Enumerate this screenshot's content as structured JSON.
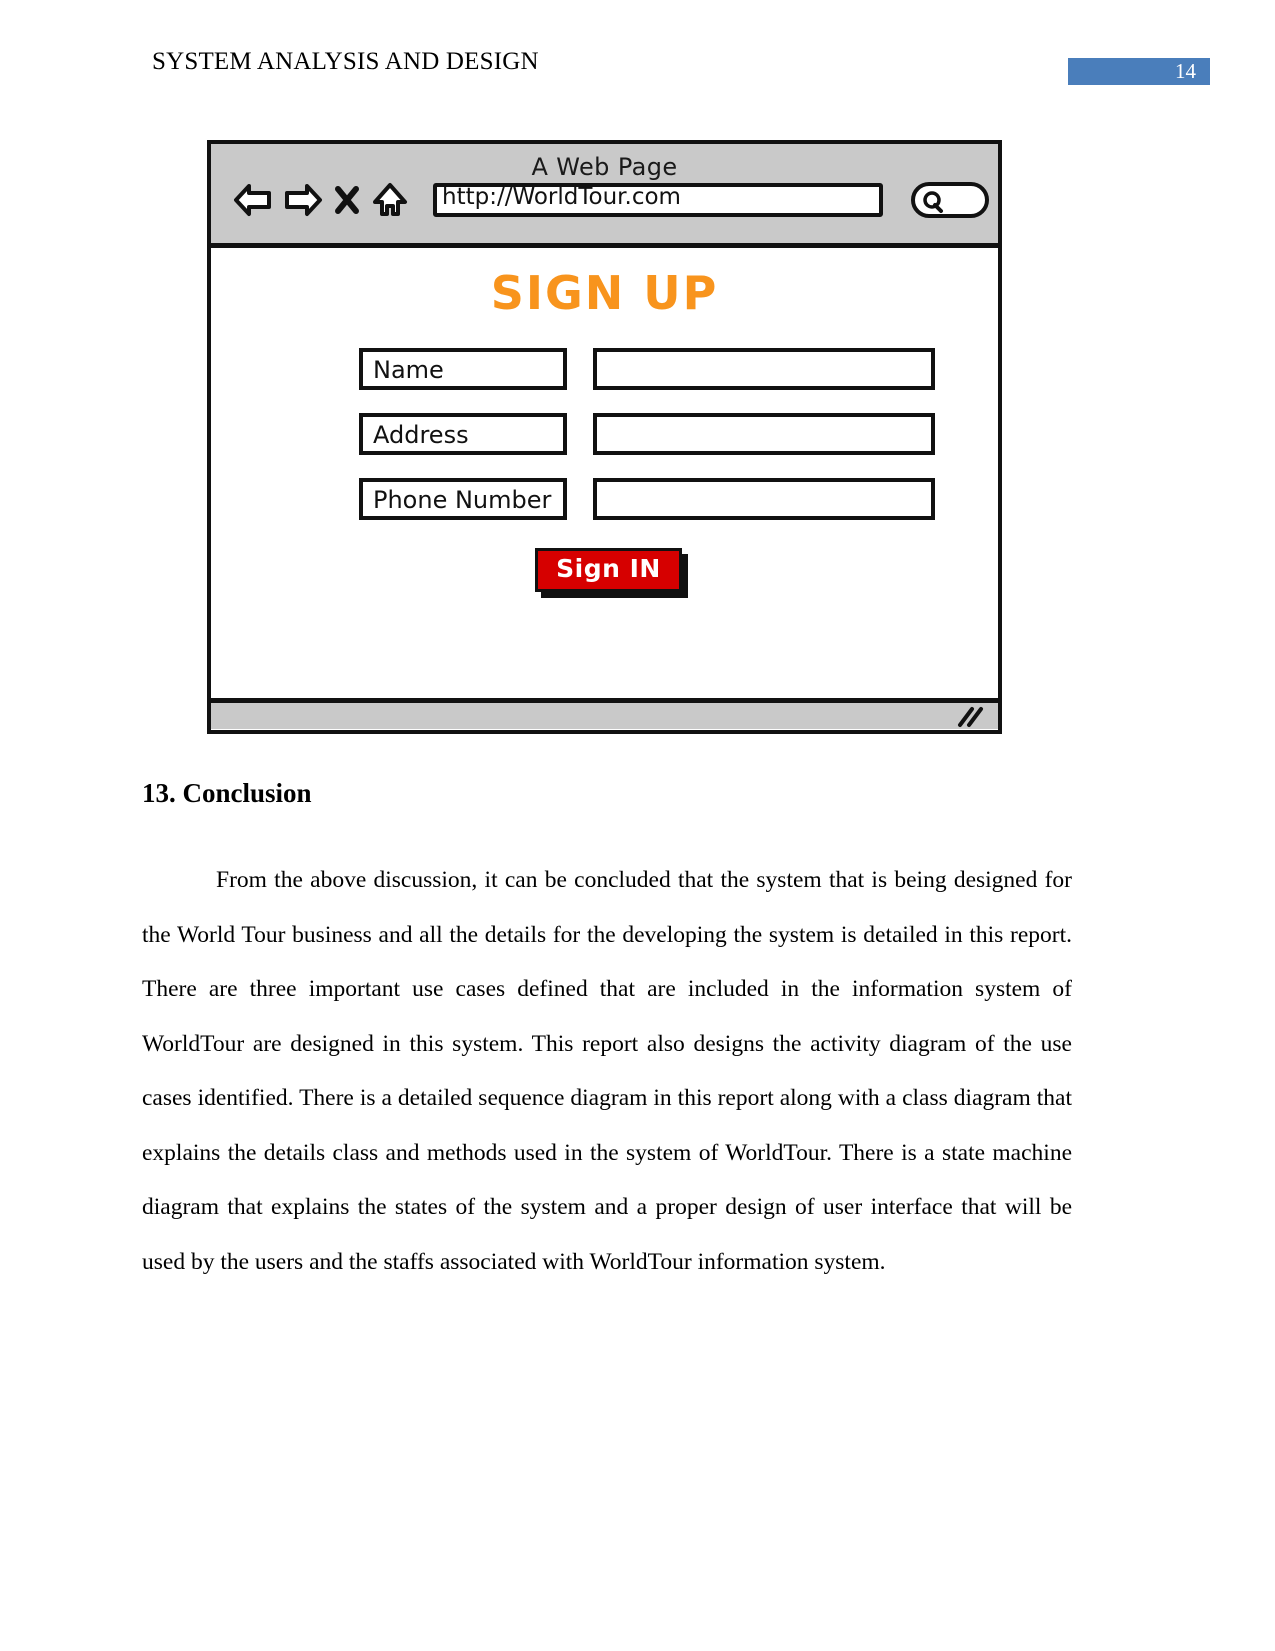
{
  "header": {
    "title": "SYSTEM ANALYSIS AND DESIGN",
    "page_number": "14",
    "badge_color": "#4A7EBB"
  },
  "mockup": {
    "window_title": "A Web Page",
    "url": "http://WorldTour.com",
    "nav_icons": [
      "back-arrow-icon",
      "forward-arrow-icon",
      "close-icon",
      "home-icon"
    ],
    "search_icon": "search-icon",
    "search_value": "",
    "form": {
      "title": "SIGN UP",
      "title_color": "#F8941D",
      "fields": [
        {
          "label": "Name",
          "value": ""
        },
        {
          "label": "Address",
          "value": ""
        },
        {
          "label": "Phone Number",
          "value": ""
        }
      ],
      "submit_label": "Sign IN",
      "submit_color": "#D60000"
    },
    "resize_handle": "resize-grip-icon"
  },
  "document": {
    "section_heading": "13. Conclusion",
    "paragraph": "From the above discussion, it can be concluded that the system that is being designed for the World Tour business and all the details for the developing the system is detailed in this report. There are three important use cases defined that are included in the information system of WorldTour are designed in this system. This report also designs the activity diagram of the use cases identified. There is a detailed sequence diagram in this report along with a class diagram that explains the details class and methods used in the system of WorldTour. There is a state machine diagram that explains the states of the system and a proper design of user interface that will be used by the users and the staffs associated with WorldTour information system."
  }
}
